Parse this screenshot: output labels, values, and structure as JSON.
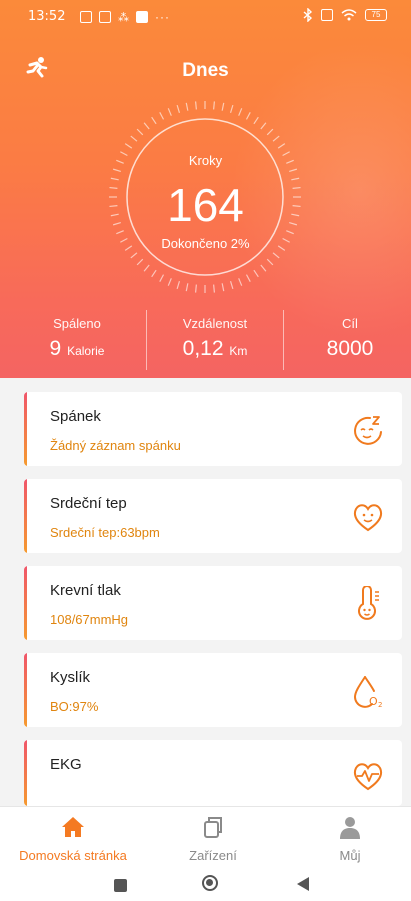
{
  "status_bar": {
    "time": "13:52",
    "battery": "75"
  },
  "header": {
    "title": "Dnes"
  },
  "steps": {
    "label": "Kroky",
    "value": "164",
    "progress_label": "Dokončeno 2%",
    "progress": 0.02
  },
  "stats": [
    {
      "label": "Spáleno",
      "value": "9",
      "unit": "Kalorie"
    },
    {
      "label": "Vzdálenost",
      "value": "0,12",
      "unit": "Km"
    },
    {
      "label": "Cíl",
      "value": "8000",
      "unit": ""
    }
  ],
  "cards": [
    {
      "name": "Spánek",
      "detail": "Žádný záznam spánku",
      "icon": "sleep-icon"
    },
    {
      "name": "Srdeční tep",
      "detail": "Srdeční tep:63bpm",
      "icon": "heart-face-icon"
    },
    {
      "name": "Krevní tlak",
      "detail": "108/67mmHg",
      "icon": "thermometer-face-icon"
    },
    {
      "name": "Kyslík",
      "detail": "BO:97%",
      "icon": "oxygen-drop-icon"
    },
    {
      "name": "EKG",
      "detail": "",
      "icon": "ekg-heart-icon"
    }
  ],
  "nav": [
    {
      "label": "Domovská stránka",
      "icon": "home-icon",
      "active": true
    },
    {
      "label": "Zařízení",
      "icon": "device-icon",
      "active": false
    },
    {
      "label": "Můj",
      "icon": "person-icon",
      "active": false
    }
  ],
  "colors": {
    "accent": "#f47a22",
    "detail_text": "#e0850f",
    "gradient_top": "#fb8a3a",
    "gradient_bottom": "#f46462"
  }
}
